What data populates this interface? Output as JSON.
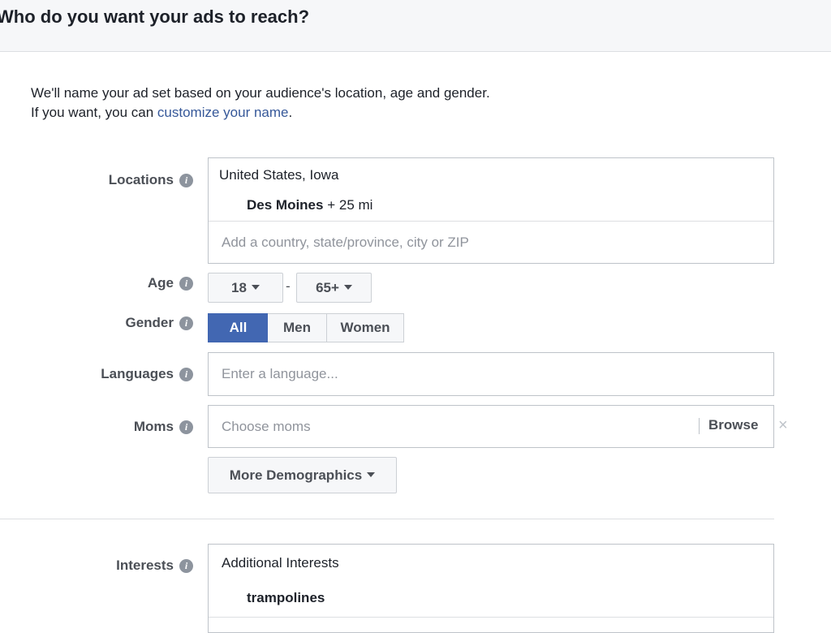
{
  "header": {
    "title": "Who do you want your ads to reach?"
  },
  "intro": {
    "line1": "We'll name your ad set based on your audience's location, age and gender.",
    "line2_prefix": "If you want, you can ",
    "line2_link": "customize your name",
    "line2_suffix": "."
  },
  "locations": {
    "label": "Locations",
    "group": "United States, Iowa",
    "city": "Des Moines",
    "radius": " + 25 mi",
    "placeholder": "Add a country, state/province, city or ZIP"
  },
  "age": {
    "label": "Age",
    "min": "18",
    "separator": "-",
    "max": "65+"
  },
  "gender": {
    "label": "Gender",
    "options": [
      "All",
      "Men",
      "Women"
    ],
    "selected": "All"
  },
  "languages": {
    "label": "Languages",
    "placeholder": "Enter a language..."
  },
  "moms": {
    "label": "Moms",
    "placeholder": "Choose moms",
    "browse": "Browse",
    "remove": "×"
  },
  "more_demographics": {
    "label": "More Demographics"
  },
  "interests": {
    "label": "Interests",
    "group": "Additional Interests",
    "item": "trampolines"
  },
  "icons": {
    "info": "info-icon",
    "caret": "caret-down-icon",
    "close": "close-icon"
  }
}
